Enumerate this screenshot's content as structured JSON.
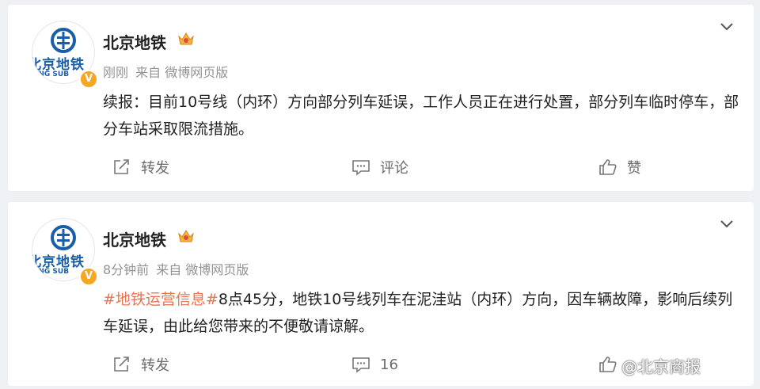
{
  "posts": [
    {
      "author": "北京地铁",
      "avatar_text": "北京地铁",
      "avatar_sub": "ING SUB",
      "verified_mark": "V",
      "time": "刚刚",
      "source": "来自 微博网页版",
      "hashtag": "",
      "text": "续报：目前10号线（内环）方向部分列车延误，工作人员正在进行处置，部分列车临时停车，部分车站采取限流措施。",
      "repost_label": "转发",
      "comment_label": "评论",
      "like_label": "赞"
    },
    {
      "author": "北京地铁",
      "avatar_text": "北京地铁",
      "avatar_sub": "ING SUB",
      "verified_mark": "V",
      "time": "8分钟前",
      "source": "来自 微博网页版",
      "hashtag": "#地铁运营信息#",
      "text": "8点45分，地铁10号线列车在泥洼站（内环）方向，因车辆故障，影响后续列车延误，由此给您带来的不便敬请谅解。",
      "repost_label": "转发",
      "comment_label": "16",
      "like_label": ""
    }
  ],
  "watermark": "@北京商报",
  "icons": {
    "chevron": "chevron-down-icon",
    "repost": "repost-icon",
    "comment": "comment-icon",
    "like": "like-icon",
    "crown": "crown-icon",
    "logo": "beijing-subway-logo-icon"
  },
  "colors": {
    "accent_blue": "#1a5ea8",
    "hashtag_orange": "#eb7350",
    "verified_orange": "#f5a623"
  }
}
